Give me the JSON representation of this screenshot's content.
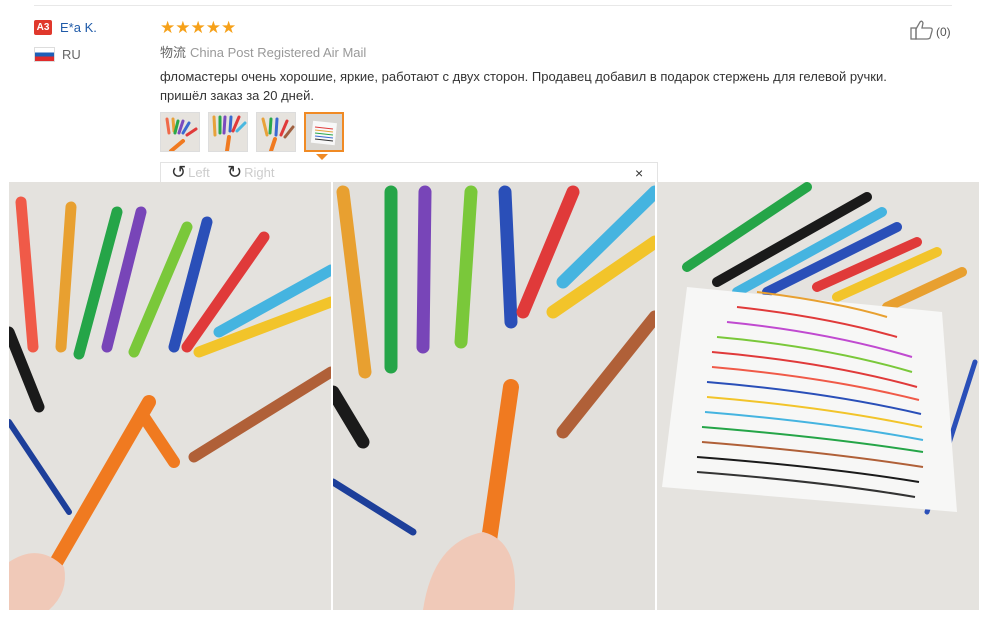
{
  "review": {
    "user_badge": "A3",
    "user_name": "E*a K.",
    "country": "RU",
    "rating_stars": "★★★★★",
    "rating": 5,
    "shipping_label": "物流",
    "shipping_method": "China Post Registered Air Mail",
    "text_line1": "фломастеры очень хорошие, яркие, работают с двух сторон. Продавец добавил в подарок стержень для гелевой ручки.",
    "text_line2": "пришёл заказ за 20 дней.",
    "helpful_count": "(0)"
  },
  "viewer": {
    "left_label": "Left",
    "right_label": "Right",
    "close_glyph": "×",
    "thumbnail_count": 4,
    "active_thumbnail": 4
  },
  "colors": {
    "star": "#f6a11a",
    "badge": "#e0382c",
    "username": "#1f5aa8",
    "active_border": "#f08a24"
  }
}
